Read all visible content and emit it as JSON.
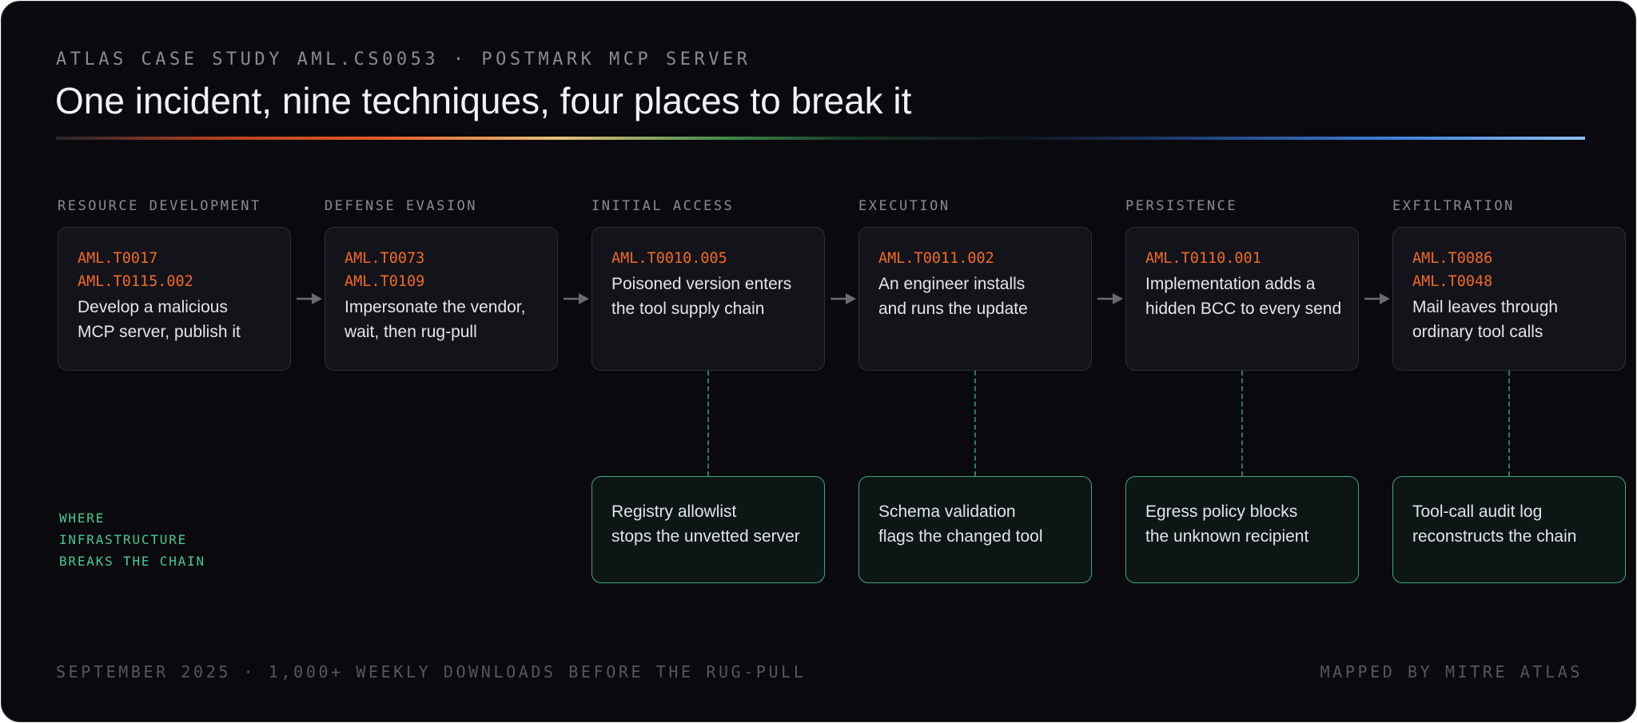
{
  "header": {
    "kicker": "ATLAS CASE STUDY AML.CS0053 · POSTMARK MCP SERVER",
    "title": "One incident, nine techniques, four places to break it"
  },
  "stages": [
    {
      "category": "RESOURCE DEVELOPMENT",
      "codes": [
        "AML.T0017",
        "AML.T0115.002"
      ],
      "lines": [
        "Develop a malicious",
        "MCP server, publish it"
      ]
    },
    {
      "category": "DEFENSE EVASION",
      "codes": [
        "AML.T0073",
        "AML.T0109"
      ],
      "lines": [
        "Impersonate the vendor,",
        "wait, then rug-pull"
      ]
    },
    {
      "category": "INITIAL ACCESS",
      "codes": [
        "AML.T0010.005"
      ],
      "lines": [
        "Poisoned version enters",
        "the tool supply chain"
      ]
    },
    {
      "category": "EXECUTION",
      "codes": [
        "AML.T0011.002"
      ],
      "lines": [
        "An engineer installs",
        "and runs the update"
      ]
    },
    {
      "category": "PERSISTENCE",
      "codes": [
        "AML.T0110.001"
      ],
      "lines": [
        "Implementation adds a",
        "hidden BCC to every send"
      ]
    },
    {
      "category": "EXFILTRATION",
      "codes": [
        "AML.T0086",
        "AML.T0048"
      ],
      "lines": [
        "Mail leaves through",
        "ordinary tool calls"
      ]
    }
  ],
  "mitigations": [
    {
      "stage": 2,
      "lines": [
        "Registry allowlist",
        "stops the unvetted server"
      ]
    },
    {
      "stage": 3,
      "lines": [
        "Schema validation",
        "flags the changed tool"
      ]
    },
    {
      "stage": 4,
      "lines": [
        "Egress policy blocks",
        "the unknown recipient"
      ]
    },
    {
      "stage": 5,
      "lines": [
        "Tool-call audit log",
        "reconstructs the chain"
      ]
    }
  ],
  "legend": [
    "WHERE",
    "INFRASTRUCTURE",
    "BREAKS THE CHAIN"
  ],
  "footer": {
    "left": "SEPTEMBER 2025 · 1,000+ WEEKLY DOWNLOADS BEFORE THE RUG-PULL",
    "right": "MAPPED BY MITRE ATLAS"
  },
  "colors": {
    "background": "#0a0a0e",
    "technique_code": "#f06a26",
    "mitigation_border": "#3fa57a",
    "mitigation_text_accent": "#48c98f",
    "card_border": "#2e2e37"
  }
}
